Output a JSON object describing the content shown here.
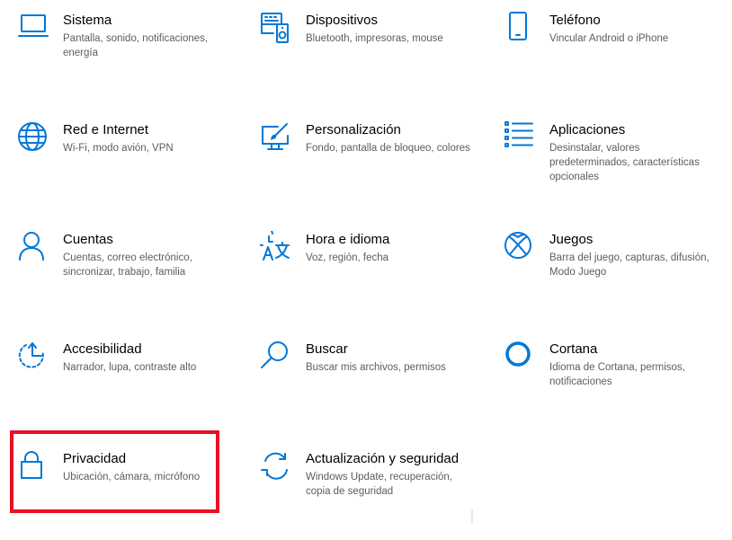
{
  "accent_color": "#0078d7",
  "highlight_color": "#e81123",
  "tiles": [
    {
      "icon": "laptop-icon",
      "title": "Sistema",
      "desc": "Pantalla, sonido, notificaciones, energía"
    },
    {
      "icon": "keyboard-speaker-icon",
      "title": "Dispositivos",
      "desc": "Bluetooth, impresoras, mouse"
    },
    {
      "icon": "phone-icon",
      "title": "Teléfono",
      "desc": "Vincular Android o iPhone"
    },
    {
      "icon": "globe-icon",
      "title": "Red e Internet",
      "desc": "Wi-Fi, modo avión, VPN"
    },
    {
      "icon": "paint-monitor-icon",
      "title": "Personalización",
      "desc": "Fondo, pantalla de bloqueo, colores"
    },
    {
      "icon": "app-list-icon",
      "title": "Aplicaciones",
      "desc": "Desinstalar, valores predeterminados, características opcionales"
    },
    {
      "icon": "person-icon",
      "title": "Cuentas",
      "desc": "Cuentas, correo electrónico, sincronizar, trabajo, familia"
    },
    {
      "icon": "time-language-icon",
      "title": "Hora e idioma",
      "desc": "Voz, región, fecha"
    },
    {
      "icon": "xbox-icon",
      "title": "Juegos",
      "desc": "Barra del juego, capturas, difusión, Modo Juego"
    },
    {
      "icon": "accessibility-icon",
      "title": "Accesibilidad",
      "desc": "Narrador, lupa, contraste alto"
    },
    {
      "icon": "search-icon",
      "title": "Buscar",
      "desc": "Buscar mis archivos, permisos"
    },
    {
      "icon": "cortana-icon",
      "title": "Cortana",
      "desc": "Idioma de Cortana, permisos, notificaciones"
    },
    {
      "icon": "lock-icon",
      "title": "Privacidad",
      "desc": "Ubicación, cámara, micrófono"
    },
    {
      "icon": "sync-icon",
      "title": "Actualización y seguridad",
      "desc": "Windows Update, recuperación, copia de seguridad"
    }
  ]
}
